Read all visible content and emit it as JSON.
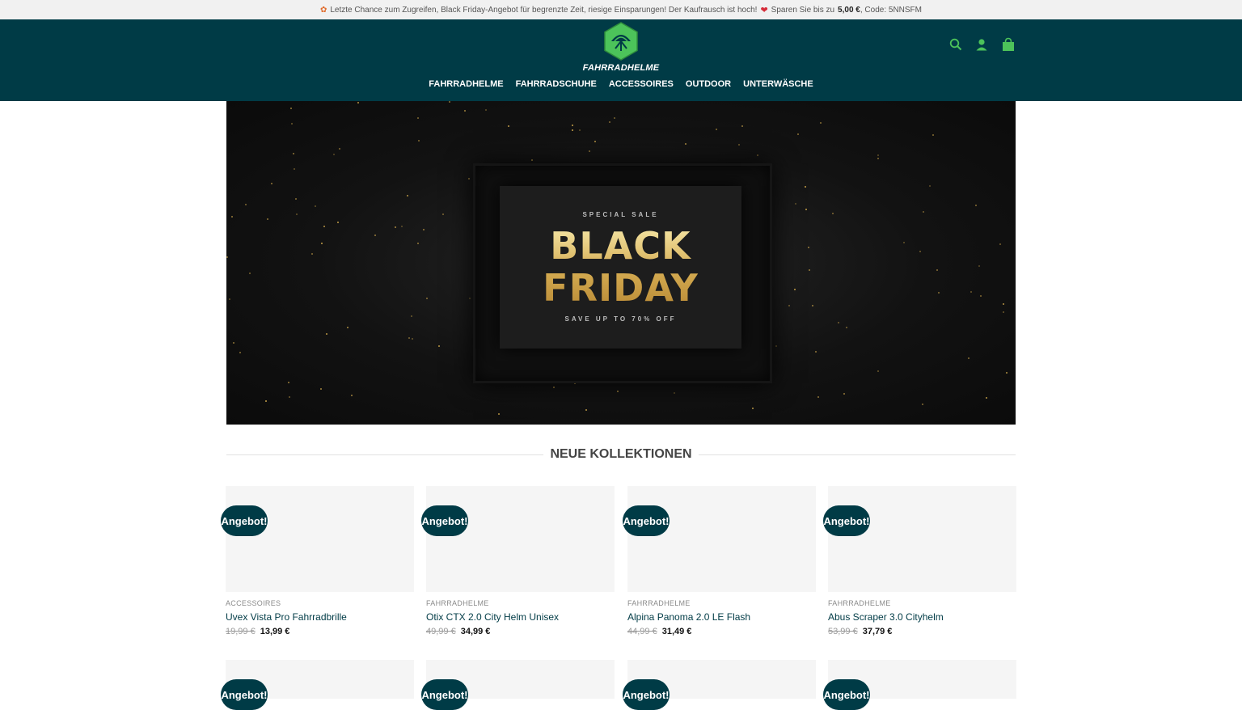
{
  "topbar": {
    "text": "Letzte Chance zum Zugreifen, Black Friday-Angebot für begrenzte Zeit, riesige Einsparungen! Der Kaufrausch ist hoch!",
    "save_prefix": "Sparen Sie bis zu",
    "save_amount": "5,00 €",
    "code_text": ", Code: 5NNSFM"
  },
  "header": {
    "logo_text": "FAHRRADHELME",
    "nav": [
      "FAHRRADHELME",
      "FAHRRADSCHUHE",
      "ACCESSOIRES",
      "OUTDOOR",
      "UNTERWÄSCHE"
    ],
    "icons": [
      "search-icon",
      "account-icon",
      "cart-icon"
    ],
    "bg_color": "#003b46",
    "logo_color": "#4cc35a"
  },
  "hero": {
    "special": "SPECIAL SALE",
    "line1": "BLACK",
    "line2": "FRIDAY",
    "saveup": "SAVE UP TO 70% OFF"
  },
  "section": {
    "title": "NEUE KOLLEKTIONEN"
  },
  "products": [
    {
      "badge": "Angebot!",
      "category": "ACCESSOIRES",
      "name": "Uvex Vista Pro Fahrradbrille",
      "old_price": "19,99 €",
      "price": "13,99 €"
    },
    {
      "badge": "Angebot!",
      "category": "FAHRRADHELME",
      "name": "Otix CTX 2.0 City Helm Unisex",
      "old_price": "49,99 €",
      "price": "34,99 €"
    },
    {
      "badge": "Angebot!",
      "category": "FAHRRADHELME",
      "name": "Alpina Panoma 2.0 LE Flash",
      "old_price": "44,99 €",
      "price": "31,49 €"
    },
    {
      "badge": "Angebot!",
      "category": "FAHRRADHELME",
      "name": "Abus Scraper 3.0 Cityhelm",
      "old_price": "53,99 €",
      "price": "37,79 €"
    }
  ],
  "products_row2": [
    {
      "badge": "Angebot!"
    },
    {
      "badge": "Angebot!"
    },
    {
      "badge": "Angebot!"
    },
    {
      "badge": "Angebot!"
    }
  ]
}
